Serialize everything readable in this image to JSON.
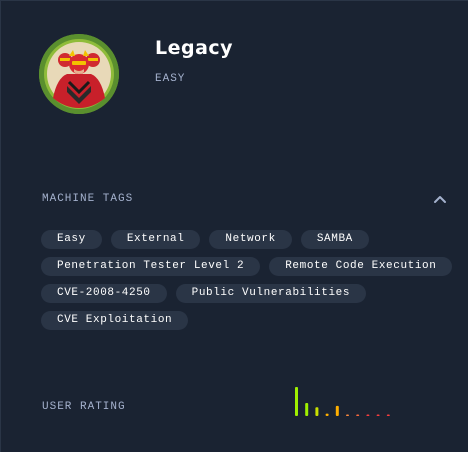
{
  "machine": {
    "name": "Legacy",
    "difficulty": "EASY"
  },
  "tags_section": {
    "label": "MACHINE TAGS",
    "rows": [
      [
        "Easy",
        "External",
        "Network",
        "SAMBA"
      ],
      [
        "Penetration Tester Level 2",
        "Remote Code Execution"
      ],
      [
        "CVE-2008-4250",
        "Public Vulnerabilities"
      ],
      [
        "CVE Exploitation"
      ]
    ]
  },
  "rating_section": {
    "label": "USER RATING",
    "bars": [
      {
        "value": 1.0,
        "color": "#9fef00"
      },
      {
        "value": 0.45,
        "color": "#9fef00"
      },
      {
        "value": 0.3,
        "color": "#c8e000"
      },
      {
        "value": 0.08,
        "color": "#ffaf00"
      },
      {
        "value": 0.35,
        "color": "#ffaf00"
      },
      {
        "value": 0.05,
        "color": "#ff8a3d"
      },
      {
        "value": 0.05,
        "color": "#ff6a3d"
      },
      {
        "value": 0.05,
        "color": "#ff3e3e"
      },
      {
        "value": 0.05,
        "color": "#ff3e3e"
      },
      {
        "value": 0.05,
        "color": "#ff3e3e"
      }
    ]
  },
  "icons": {
    "avatar": "legacy-avatar-icon",
    "chevron": "chevron-up-icon"
  },
  "colors": {
    "background": "#1a2332",
    "tag_bg": "#2a3546",
    "muted_text": "#a4b1cd",
    "avatar_ring": "#5a8f2e"
  }
}
